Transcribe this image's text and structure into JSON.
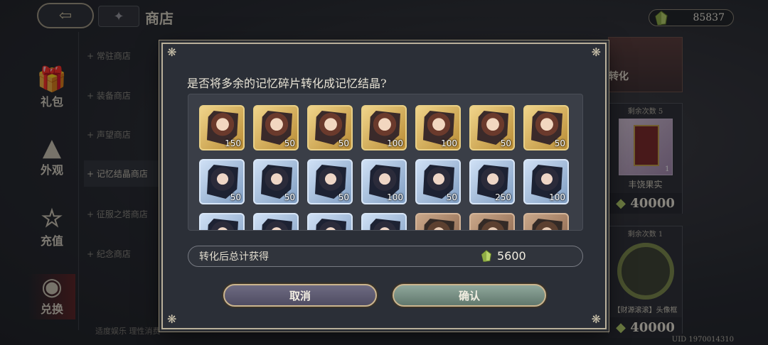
{
  "header": {
    "title": "商店",
    "back_icon": "back-arrow-icon",
    "home_icon": "home-icon"
  },
  "currency": {
    "amount": "85837",
    "icon": "crystal-gem-icon"
  },
  "left_nav": [
    {
      "label": "",
      "icon": "partial-icon"
    },
    {
      "label": "礼包",
      "icon": "gift-icon"
    },
    {
      "label": "外观",
      "icon": "shirt-icon"
    },
    {
      "label": "充值",
      "icon": "star-icon"
    },
    {
      "label": "兑换",
      "icon": "coin-exchange-icon"
    }
  ],
  "shop_list": [
    "常驻商店",
    "装备商店",
    "声望商店",
    "记忆结晶商店",
    "征服之塔商店",
    "纪念商店"
  ],
  "footer_note": "适度娱乐 理性消费",
  "right_cards": [
    {
      "count_label": "剩余次数 5",
      "name": "丰饶果实",
      "price": "40000",
      "corner_num": "1"
    },
    {
      "count_label": "剩余次数 1",
      "name": "【财源滚滚】头像框",
      "price": "40000"
    }
  ],
  "right_banner_label": "转化",
  "uid": "UID 1970014310",
  "dialog": {
    "title": "是否将多余的记忆碎片转化成记忆结晶?",
    "items": [
      {
        "rarity": "gold",
        "qty": "150"
      },
      {
        "rarity": "gold",
        "qty": "50"
      },
      {
        "rarity": "gold",
        "qty": "50"
      },
      {
        "rarity": "gold",
        "qty": "100"
      },
      {
        "rarity": "gold",
        "qty": "100"
      },
      {
        "rarity": "gold",
        "qty": "50"
      },
      {
        "rarity": "gold",
        "qty": "50"
      },
      {
        "rarity": "blue",
        "qty": "50"
      },
      {
        "rarity": "blue",
        "qty": "50"
      },
      {
        "rarity": "blue",
        "qty": "50"
      },
      {
        "rarity": "blue",
        "qty": "100"
      },
      {
        "rarity": "blue",
        "qty": "50"
      },
      {
        "rarity": "blue",
        "qty": "250"
      },
      {
        "rarity": "blue",
        "qty": "100"
      },
      {
        "rarity": "blue",
        "qty": ""
      },
      {
        "rarity": "blue",
        "qty": ""
      },
      {
        "rarity": "blue",
        "qty": ""
      },
      {
        "rarity": "blue",
        "qty": ""
      },
      {
        "rarity": "bronze",
        "qty": ""
      },
      {
        "rarity": "bronze",
        "qty": ""
      },
      {
        "rarity": "bronze",
        "qty": ""
      }
    ],
    "total_label": "转化后总计获得",
    "total_value": "5600",
    "cancel_label": "取消",
    "confirm_label": "确认"
  }
}
